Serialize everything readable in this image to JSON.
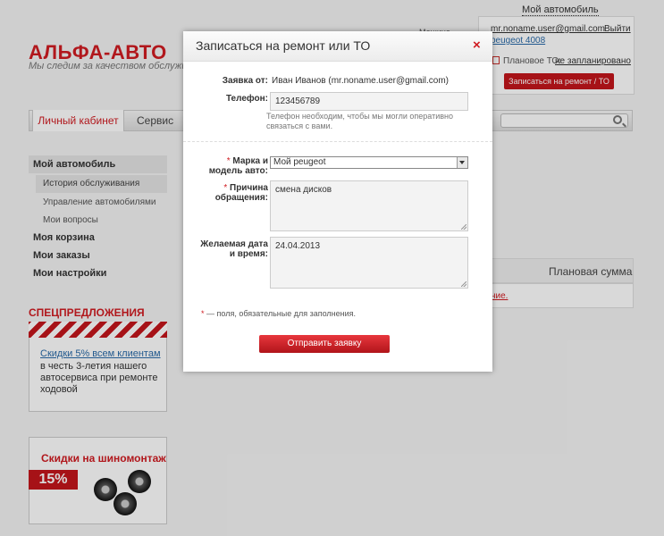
{
  "site": {
    "logo": "АЛЬФА-АВТО",
    "tagline": "Мы следим за качеством обслуживания"
  },
  "account": {
    "my_car_link": "Мой автомобиль",
    "label_fragment": "Машина",
    "email": "mr.noname.user@gmail.com",
    "exit": "Выйти",
    "car": "peugeot 4008",
    "to_label": "Плановое ТО:",
    "to_value": "не запланировано",
    "book_button": "Записаться на ремонт / ТО"
  },
  "nav": {
    "items": [
      "Личный кабинет",
      "Сервис"
    ],
    "search_placeholder": ""
  },
  "sidebar": {
    "section": "Мой автомобиль",
    "subitems": [
      "История обслуживания",
      "Управление автомобилями",
      "Мои вопросы"
    ],
    "items": [
      "Моя корзина",
      "Мои заказы",
      "Мои настройки"
    ]
  },
  "promo": {
    "title": "СПЕЦПРЕДЛОЖЕНИЯ",
    "link": "Скидки 5% всем клиентам",
    "text": "в честь 3-летия нашего автосервиса при ремонте ходовой"
  },
  "tire_promo": {
    "title": "Скидки на шиномонтаж",
    "percent": "15%"
  },
  "table": {
    "header": "Плановая сумма",
    "row_fragment": "ние."
  },
  "modal": {
    "title": "Записаться на ремонт или ТО",
    "close": "×",
    "from_label": "Заявка от:",
    "from_value": "Иван Иванов (mr.noname.user@gmail.com)",
    "phone_label": "Телефон:",
    "phone_value": "123456789",
    "phone_hint": "Телефон необходим, чтобы мы могли оперативно связаться с вами.",
    "car_label_1": "Марка и",
    "car_label_2": "модель авто:",
    "car_value": "Мой peugeot",
    "reason_label_1": "Причина",
    "reason_label_2": "обращения:",
    "reason_value": "смена дисков",
    "date_label_1": "Желаемая дата",
    "date_label_2": "и время:",
    "date_value": "24.04.2013",
    "required_mark": "*",
    "required_note": " — поля, обязательные для заполнения.",
    "submit": "Отправить заявку"
  },
  "colors": {
    "accent": "#d01c22",
    "link": "#2a6aa8"
  }
}
